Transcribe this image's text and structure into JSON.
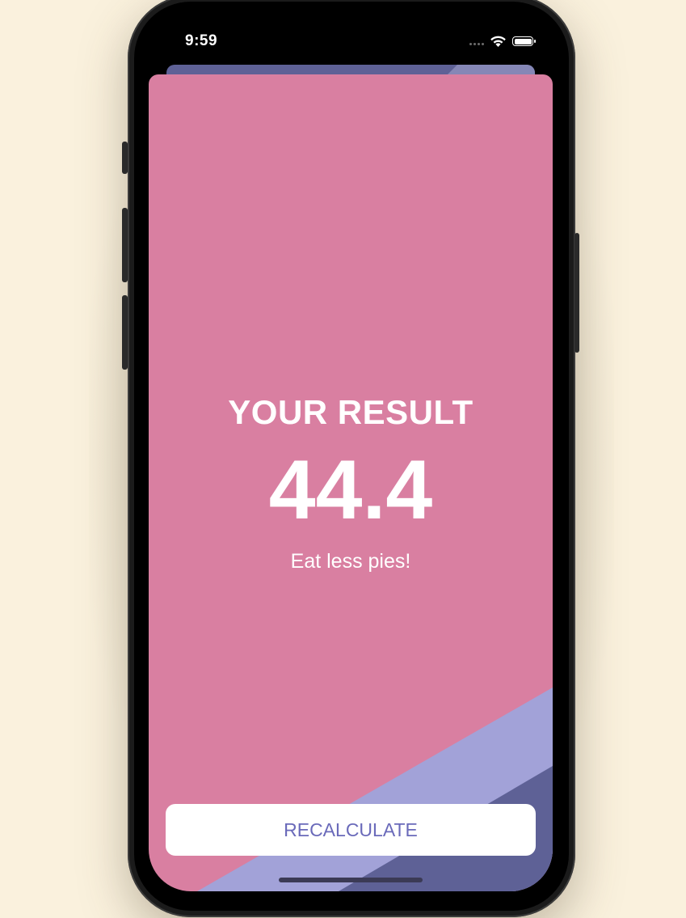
{
  "status_bar": {
    "time": "9:59"
  },
  "result": {
    "title": "YOUR RESULT",
    "value": "44.4",
    "advice": "Eat less pies!"
  },
  "actions": {
    "recalculate_label": "RECALCULATE"
  },
  "colors": {
    "sheet_background": "#d97fa1",
    "diagonal_light": "#a2a2d8",
    "diagonal_dark": "#5e6196",
    "button_text": "#6a6aba"
  }
}
